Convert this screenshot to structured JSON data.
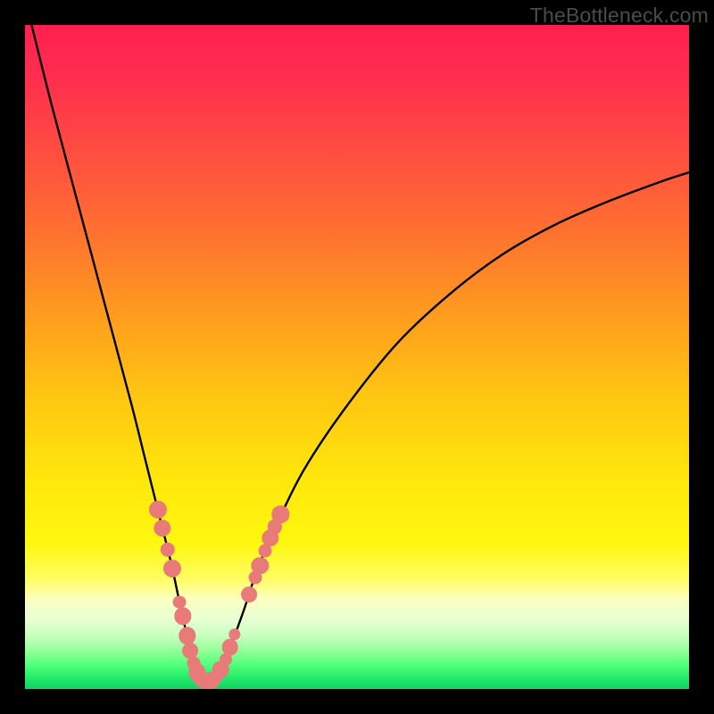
{
  "watermark": "TheBottleneck.com",
  "colors": {
    "black": "#000000",
    "marker": "#e97a7a",
    "curve": "#000000"
  },
  "gradient_stops": [
    {
      "offset": 0.0,
      "color": "#ff2050"
    },
    {
      "offset": 0.08,
      "color": "#ff2e4e"
    },
    {
      "offset": 0.18,
      "color": "#ff4a42"
    },
    {
      "offset": 0.3,
      "color": "#ff6d32"
    },
    {
      "offset": 0.42,
      "color": "#ff9620"
    },
    {
      "offset": 0.55,
      "color": "#ffc312"
    },
    {
      "offset": 0.68,
      "color": "#ffe60c"
    },
    {
      "offset": 0.78,
      "color": "#fff80e"
    },
    {
      "offset": 0.835,
      "color": "#fffd65"
    },
    {
      "offset": 0.865,
      "color": "#fbffc0"
    },
    {
      "offset": 0.895,
      "color": "#e8ffd4"
    },
    {
      "offset": 0.92,
      "color": "#c8ffbe"
    },
    {
      "offset": 0.945,
      "color": "#8cff94"
    },
    {
      "offset": 0.965,
      "color": "#4dff79"
    },
    {
      "offset": 0.985,
      "color": "#1fe96a"
    },
    {
      "offset": 1.0,
      "color": "#17d064"
    }
  ],
  "chart_data": {
    "type": "line",
    "title": "",
    "xlabel": "",
    "ylabel": "",
    "xlim": [
      0,
      100
    ],
    "ylim": [
      0,
      100
    ],
    "grid": false,
    "series": [
      {
        "name": "bottleneck-curve",
        "x": [
          1,
          4,
          8,
          12,
          16,
          18,
          20,
          22,
          23.5,
          25,
          26,
          27,
          28,
          29.5,
          31,
          33,
          35,
          38,
          42,
          48,
          56,
          64,
          72,
          80,
          88,
          96,
          100
        ],
        "y": [
          100,
          88,
          73,
          58,
          43,
          35,
          27,
          19,
          12,
          5.5,
          2.2,
          1.1,
          1.1,
          2.6,
          6.5,
          12,
          18,
          25,
          33,
          42,
          52,
          59.5,
          65.5,
          70,
          73.5,
          76.5,
          77.8
        ]
      }
    ],
    "markers": {
      "name": "highlight-dots",
      "color": "#e97a7a",
      "approx_radius_pct": 1.3,
      "points": [
        {
          "x": 20.0,
          "y": 27.0,
          "r": 1.35
        },
        {
          "x": 20.7,
          "y": 24.2,
          "r": 1.3
        },
        {
          "x": 21.5,
          "y": 21.0,
          "r": 1.1
        },
        {
          "x": 22.2,
          "y": 18.2,
          "r": 1.35
        },
        {
          "x": 23.3,
          "y": 13.1,
          "r": 1.0
        },
        {
          "x": 23.8,
          "y": 11.0,
          "r": 1.3
        },
        {
          "x": 24.4,
          "y": 8.0,
          "r": 1.3
        },
        {
          "x": 24.9,
          "y": 5.8,
          "r": 1.2
        },
        {
          "x": 25.4,
          "y": 3.9,
          "r": 1.0
        },
        {
          "x": 25.9,
          "y": 2.5,
          "r": 1.3
        },
        {
          "x": 26.6,
          "y": 1.5,
          "r": 1.25
        },
        {
          "x": 27.3,
          "y": 1.1,
          "r": 1.25
        },
        {
          "x": 28.1,
          "y": 1.3,
          "r": 1.25
        },
        {
          "x": 28.9,
          "y": 2.0,
          "r": 1.0
        },
        {
          "x": 29.5,
          "y": 2.9,
          "r": 1.25
        },
        {
          "x": 30.2,
          "y": 4.5,
          "r": 0.95
        },
        {
          "x": 30.9,
          "y": 6.3,
          "r": 1.25
        },
        {
          "x": 31.6,
          "y": 8.2,
          "r": 0.9
        },
        {
          "x": 33.8,
          "y": 14.2,
          "r": 1.2
        },
        {
          "x": 34.7,
          "y": 16.8,
          "r": 1.0
        },
        {
          "x": 35.4,
          "y": 18.6,
          "r": 1.3
        },
        {
          "x": 36.2,
          "y": 20.8,
          "r": 1.0
        },
        {
          "x": 36.9,
          "y": 22.7,
          "r": 1.3
        },
        {
          "x": 37.6,
          "y": 24.4,
          "r": 1.1
        },
        {
          "x": 38.5,
          "y": 26.3,
          "r": 1.3
        }
      ]
    }
  }
}
